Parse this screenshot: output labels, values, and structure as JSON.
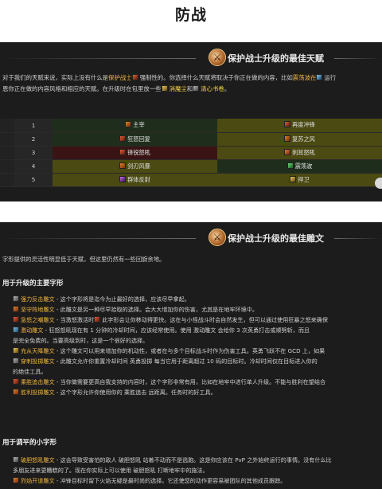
{
  "page_title": "防战",
  "talents_section": {
    "title": "保护战士升级的最佳天赋",
    "intro_line1_a": "对于我们的天赋来说，实际上没有什么是",
    "intro_line1_hl": "保护战士",
    "intro_line1_b": "强制性的。你选择什么天赋将取决于你正在做的内容，比如",
    "intro_line1_hl2": "震荡波在",
    "intro_line1_c": "运行",
    "intro_line2_a": "恩你正在做的内容风格和相应的天赋。在升级时在包里放一些",
    "intro_line2_hl": "消魔尘",
    "intro_line2_b": "和",
    "intro_line2_hl2": "清心书卷",
    "intro_line2_c": "。",
    "rows": [
      {
        "level": "1",
        "left": "主宰",
        "right": "再度冲锋"
      },
      {
        "level": "2",
        "left": "狂怒回复",
        "right": "复苏之风"
      },
      {
        "level": "3",
        "left": "锋锐怒吼",
        "right": "刺耳怒吼"
      },
      {
        "level": "4",
        "left": "剑刃风暴",
        "right": "震荡波"
      },
      {
        "level": "5",
        "left": "群体反射",
        "right": "捍卫"
      }
    ]
  },
  "glyphs_section": {
    "title": "保护战士升级的最佳雕文",
    "intro": "字形提供的灵活性明显低于天赋，但这里仍然有一些回旋余地。",
    "major_heading": "用于升级的主要字形",
    "major_items": [
      {
        "name": "强力反击雕文",
        "text": " - 这个字形将是迄今为止最好的选择，应该尽早拿起。"
      },
      {
        "name": "坚守阵地雕文",
        "text": " - 此雕文是另一种尽早拾取的选择。会大大增加你的伤害，尤其是在地牢环境中。"
      },
      {
        "name": "急怒之嘲雕文",
        "text": " - 当激怒激活时",
        "tail": "此字形会让你移动得更快。这在与小怪战斗时会自然发生，但可以通过使用狂暴之怒来确保"
      },
      {
        "name": "激动雕文",
        "text": " - 狂怒怒吼现在有 1 分钟的冷却时间，应该经常使用。使用 激动雕文 会给你 3 次英勇打击或顺劈斩，而且",
        "line2": "是完全免费的。当要高级到时，这是一个很好的选择。"
      },
      {
        "name": "充从天降雕文",
        "text": " - 这个雕文可以用来增加你的机动性，或者在与多个目标战斗时作为伤害工具。英勇飞跃不在 GCD 上，如果"
      },
      {
        "name": "穿刺投掷雕文",
        "text": " - 此雕文允许你重置冷却时间 英勇投掷 每当它用于距离超过 10 码的目标时。冷却时间仅在目标进入你的",
        "line2": "的绝佳工具。"
      },
      {
        "name": "乘胜追击雕文",
        "text": " - 当你做需要更高自我支持的内容时，这个字形非常有用，比如在地牢中进行单人升级。不能与胜利在望结合"
      },
      {
        "name": "胜利投掷雕文",
        "text": " - 这个字形允许你使用你的 乘胜追击 远距离。任务时的好工具。"
      }
    ],
    "minor_heading": "用于调平的小字形",
    "minor_items": [
      {
        "name": "破胆怒吼雕文",
        "text": " - 这会导致受害怕的敌人 破胆怒吼 站着不动而不是逃跑。这是你应该在 PvP 之外始终运行的事情。没有什么比",
        "line2": "多朋友进来更糟糕的了。现在你实际上可以使用 破胆怒吼 打断地牢中的施法。"
      },
      {
        "name": "烈焰开道雕文",
        "text": " - 冲锋目标时留下火焰无疑是最时尚的选择。它还使您的动作更容易被团队的其他成员跟踪。"
      }
    ]
  }
}
